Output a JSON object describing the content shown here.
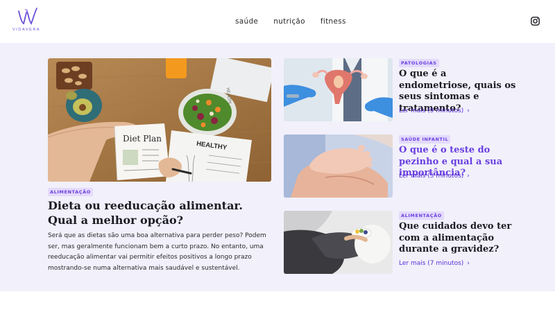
{
  "brand": {
    "name": "VIDAVERA",
    "color": "#6b4fd8"
  },
  "nav": {
    "items": [
      "saúde",
      "nutrição",
      "fitness"
    ]
  },
  "header": {
    "social_icon": "instagram-icon"
  },
  "featured": {
    "tag": "ALIMENTAÇÃO",
    "title": "Dieta ou reeducação alimentar. Qual a melhor opção?",
    "description": "Será que as dietas são uma boa alternativa para perder peso? Podem ser, mas geralmente funcionam bem a curto prazo. No entanto, uma reeducação alimentar vai permitir efeitos positivos a longo prazo mostrando-se numa alternativa mais saudável e sustentável.",
    "image_text": {
      "notebook": "Diet Plan",
      "sheet": "HEALTHY"
    }
  },
  "cards": [
    {
      "tag": "PATOLOGIAS",
      "title": "O que é a endometriose, quais os seus sintomas e tratamento?",
      "link": "Ler mais (9 minutos)"
    },
    {
      "tag": "SAÚDE INFANTIL",
      "title": "O que é o teste do pezinho e qual a sua importância?",
      "link": "Ler mais (5 minutos)"
    },
    {
      "tag": "ALIMENTAÇÃO",
      "title": "Que cuidados devo ter com a alimentação durante a gravidez?",
      "link": "Ler mais (7 minutos)"
    }
  ],
  "colors": {
    "accent": "#6a3fe0",
    "tag_bg": "#e3dafc",
    "section_bg": "#f1f0fb"
  }
}
